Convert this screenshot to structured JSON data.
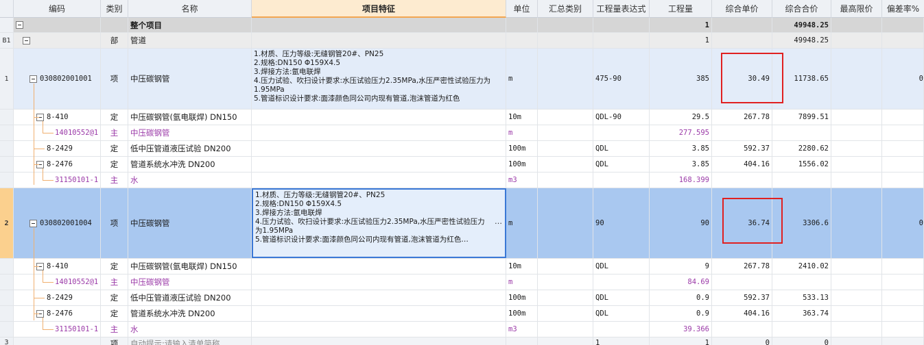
{
  "columns": {
    "code": "编码",
    "type": "类别",
    "name": "名称",
    "feature": "项目特征",
    "unit": "单位",
    "summary_type": "汇总类别",
    "qty_expr": "工程量表达式",
    "qty": "工程量",
    "unit_price": "综合单价",
    "total_price": "综合合价",
    "max_limit": "最高限价",
    "deviation": "偏差率%"
  },
  "rows": {
    "total": {
      "name": "整个项目",
      "qty": "1",
      "total_price": "49948.25"
    },
    "sub": {
      "rownum": "B1",
      "type": "部",
      "name": "管道",
      "qty": "1",
      "total_price": "49948.25"
    },
    "item1": {
      "rownum": "1",
      "code": "030802001001",
      "type": "项",
      "name": "中压碳钢管",
      "feature": [
        "1.材质、压力等级:无缝钢管20#、PN25",
        "2.规格:DN150 Φ159X4.5",
        "3.焊接方法:氩电联焊",
        "4.压力试验、吹扫设计要求:水压试验压力2.35MPa,水压严密性试验压力为1.95MPa",
        "5.管道标识设计要求:面漆颜色同公司内现有管道,泡沫管道为红色"
      ],
      "unit": "m",
      "qty_expr": "475-90",
      "qty": "385",
      "unit_price": "30.49",
      "total_price": "11738.65",
      "deviation": "0"
    },
    "r1_1": {
      "code": "8-410",
      "type": "定",
      "name": "中压碳钢管(氩电联焊) DN150",
      "unit": "10m",
      "qty_expr": "QDL-90",
      "qty": "29.5",
      "unit_price": "267.78",
      "total_price": "7899.51"
    },
    "r1_2": {
      "code": "14010552@1",
      "type": "主",
      "name": "中压碳钢管",
      "unit": "m",
      "qty": "277.595"
    },
    "r1_3": {
      "code": "8-2429",
      "type": "定",
      "name": "低中压管道液压试验 DN200",
      "unit": "100m",
      "qty_expr": "QDL",
      "qty": "3.85",
      "unit_price": "592.37",
      "total_price": "2280.62"
    },
    "r1_4": {
      "code": "8-2476",
      "type": "定",
      "name": "管道系统水冲洗 DN200",
      "unit": "100m",
      "qty_expr": "QDL",
      "qty": "3.85",
      "unit_price": "404.16",
      "total_price": "1556.02"
    },
    "r1_5": {
      "code": "31150101-1",
      "type": "主",
      "name": "水",
      "unit": "m3",
      "qty": "168.399"
    },
    "item2": {
      "rownum": "2",
      "code": "030802001004",
      "type": "项",
      "name": "中压碳钢管",
      "feature": [
        "1.材质、压力等级:无缝钢管20#、PN25",
        "2.规格:DN150 Φ159X4.5",
        "3.焊接方法:氩电联焊",
        "4.压力试验、吹扫设计要求:水压试验压力2.35MPa,水压严密性试验压力为1.95MPa",
        "5.管道标识设计要求:面漆颜色同公司内现有管道,泡沫管道为红色…"
      ],
      "ellipsis": "…",
      "unit": "m",
      "qty_expr": "90",
      "qty": "90",
      "unit_price": "36.74",
      "total_price": "3306.6",
      "deviation": "0"
    },
    "r2_1": {
      "code": "8-410",
      "type": "定",
      "name": "中压碳钢管(氩电联焊) DN150",
      "unit": "10m",
      "qty_expr": "QDL",
      "qty": "9",
      "unit_price": "267.78",
      "total_price": "2410.02"
    },
    "r2_2": {
      "code": "14010552@1",
      "type": "主",
      "name": "中压碳钢管",
      "unit": "m",
      "qty": "84.69"
    },
    "r2_3": {
      "code": "8-2429",
      "type": "定",
      "name": "低中压管道液压试验 DN200",
      "unit": "100m",
      "qty_expr": "QDL",
      "qty": "0.9",
      "unit_price": "592.37",
      "total_price": "533.13"
    },
    "r2_4": {
      "code": "8-2476",
      "type": "定",
      "name": "管道系统水冲洗 DN200",
      "unit": "100m",
      "qty_expr": "QDL",
      "qty": "0.9",
      "unit_price": "404.16",
      "total_price": "363.74"
    },
    "r2_5": {
      "code": "31150101-1",
      "type": "主",
      "name": "水",
      "unit": "m3",
      "qty": "39.366"
    },
    "item3": {
      "rownum": "3",
      "type": "项",
      "name": "自动提示:请输入清单简称",
      "qty_expr": "1",
      "qty": "1",
      "unit_price": "0",
      "total_price": "0"
    }
  },
  "colors": {
    "highlight_box": "#e02020",
    "selected_row": "#a9c8f0",
    "main_material_text": "#9b3aa8"
  }
}
